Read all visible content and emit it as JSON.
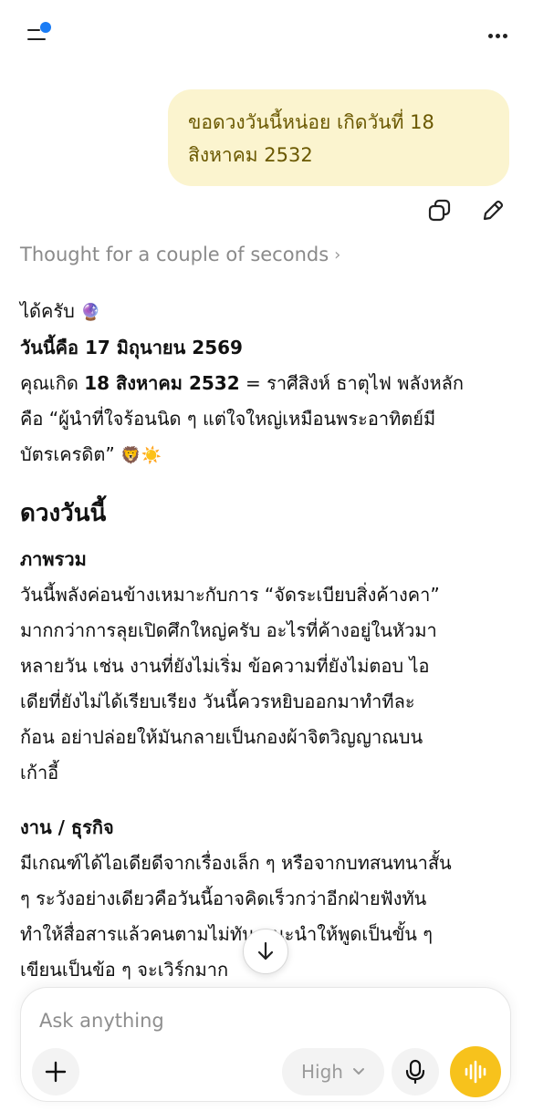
{
  "colors": {
    "accent_dot": "#1a7cf5",
    "user_bubble_bg": "#fbf4cf",
    "user_bubble_text": "#6a5800",
    "voice_button": "#f7c21c"
  },
  "header": {
    "menu_icon": "menu-icon",
    "more_icon": "more-icon"
  },
  "user_message": {
    "text": "ขอดวงวันนี้หน่อย เกิดวันที่ 18 สิงหาคม 2532"
  },
  "message_actions": {
    "copy_icon": "copy-icon",
    "edit_icon": "edit-icon"
  },
  "thought": {
    "label": "Thought for a couple of seconds",
    "chevron": "›"
  },
  "answer": {
    "greeting": "ได้ครับ",
    "greeting_emoji": "🔮",
    "today_prefix": "วันนี้คือ ",
    "today_date": "17 มิถุนายน 2569",
    "birth_prefix": "คุณเกิด ",
    "birth_date": "18 สิงหาคม 2532",
    "birth_line1_rest": " = ราศีสิงห์ ธาตุไฟ พลังหลัก",
    "birth_line2": "คือ “ผู้นำที่ใจร้อนนิด ๆ แต่ใจใหญ่เหมือนพระอาทิตย์มี",
    "birth_line3": "บัตรเครดิต”",
    "birth_emoji": "🦁☀️",
    "heading": "ดวงวันนี้",
    "sections": [
      {
        "title": "ภาพรวม",
        "lines": [
          "วันนี้พลังค่อนข้างเหมาะกับการ “จัดระเบียบสิ่งค้างคา”",
          "มากกว่าการลุยเปิดศึกใหญ่ครับ อะไรที่ค้างอยู่ในหัวมา",
          "หลายวัน เช่น งานที่ยังไม่เริ่ม ข้อความที่ยังไม่ตอบ ไอ",
          "เดียที่ยังไม่ได้เรียบเรียง วันนี้ควรหยิบออกมาทำทีละ",
          "ก้อน อย่าปล่อยให้มันกลายเป็นกองผ้าจิตวิญญาณบน",
          "เก้าอี้"
        ]
      },
      {
        "title": "งาน / ธุรกิจ",
        "lines": [
          "มีเกณฑ์ได้ไอเดียดีจากเรื่องเล็ก ๆ หรือจากบทสนทนาสั้น",
          "ๆ ระวังอย่างเดียวคือวันนี้อาจคิดเร็วกว่าอีกฝ่ายฟังทัน",
          "ทำให้สื่อสารแล้วคนตามไม่ทัน แนะนำให้พูดเป็นขั้น ๆ",
          "เขียนเป็นข้อ ๆ จะเวิร์กมาก"
        ]
      }
    ]
  },
  "composer": {
    "placeholder": "Ask anything",
    "model_label": "High",
    "plus_icon": "plus-icon",
    "mic_icon": "mic-icon",
    "voice_icon": "voice-waveform-icon",
    "scroll_icon": "arrow-down-icon"
  }
}
